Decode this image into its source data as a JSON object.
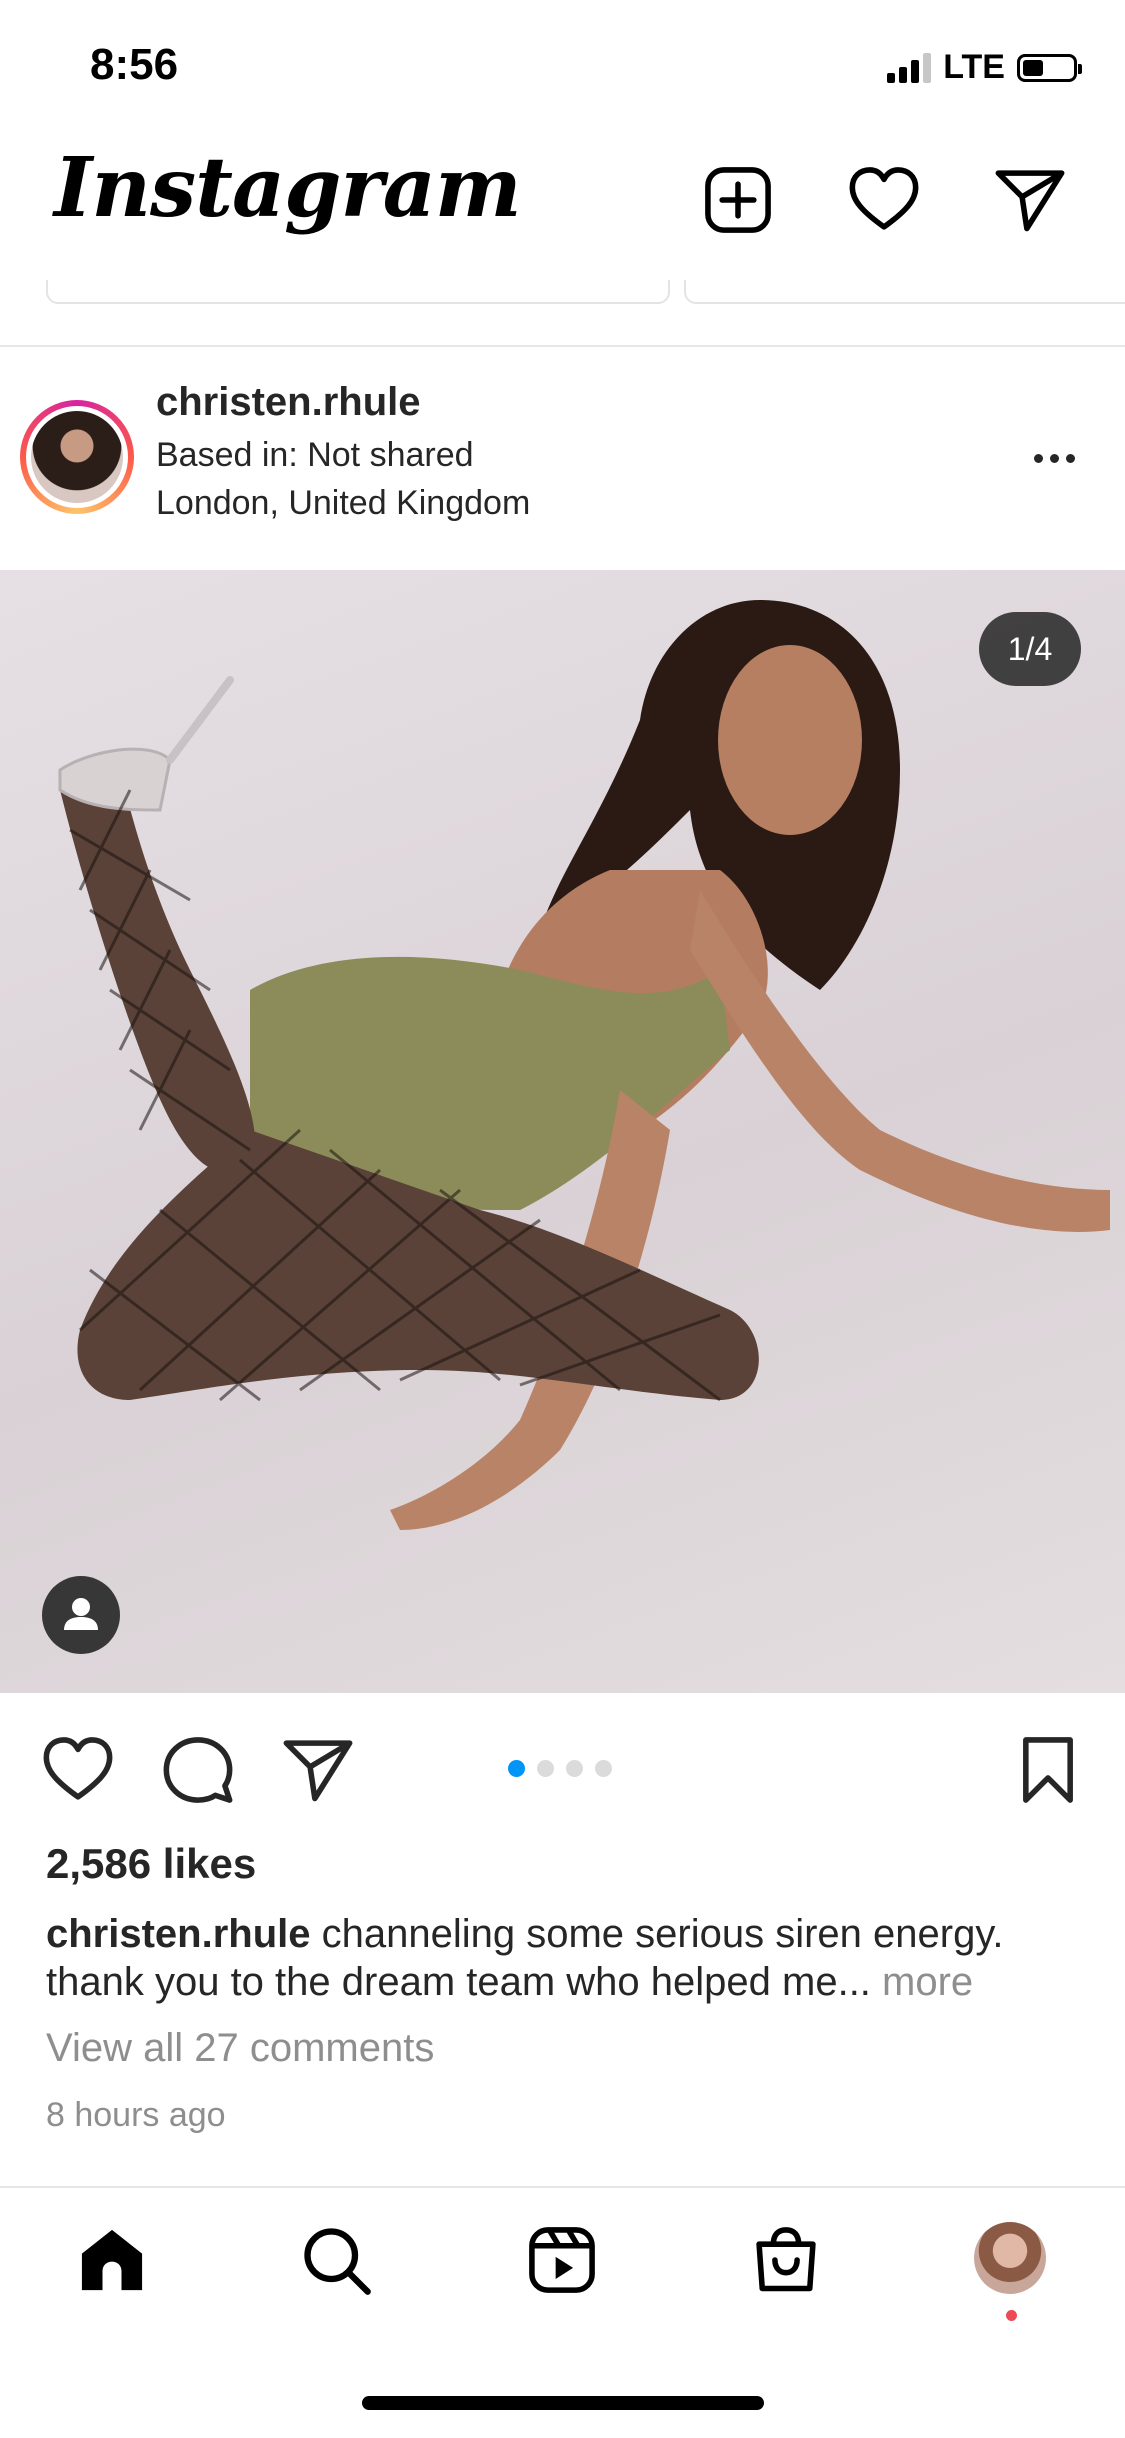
{
  "status_bar": {
    "time": "8:56",
    "network": "LTE",
    "battery_level": 0.35
  },
  "header": {
    "logo": "Instagram",
    "icons": [
      "new-post-icon",
      "heart-icon",
      "direct-message-icon"
    ]
  },
  "post": {
    "username": "christen.rhule",
    "location_line1": "Based in: Not shared",
    "location_line2": "London, United Kingdom",
    "image_counter": "1/4",
    "carousel_total": 4,
    "carousel_active": 1,
    "likes": "2,586 likes",
    "caption_user": "christen.rhule",
    "caption_text": " channeling some serious siren energy. thank you to the dream team who helped me... ",
    "caption_more": "more",
    "view_comments": "View all 27 comments",
    "time_ago": "8 hours ago"
  },
  "colors": {
    "accent": "#0095f6",
    "text": "#262626",
    "muted": "#8e8e8e",
    "notification": "#ed4956"
  },
  "bottom_nav": [
    "home-icon",
    "search-icon",
    "reels-icon",
    "shop-icon",
    "profile-avatar"
  ]
}
